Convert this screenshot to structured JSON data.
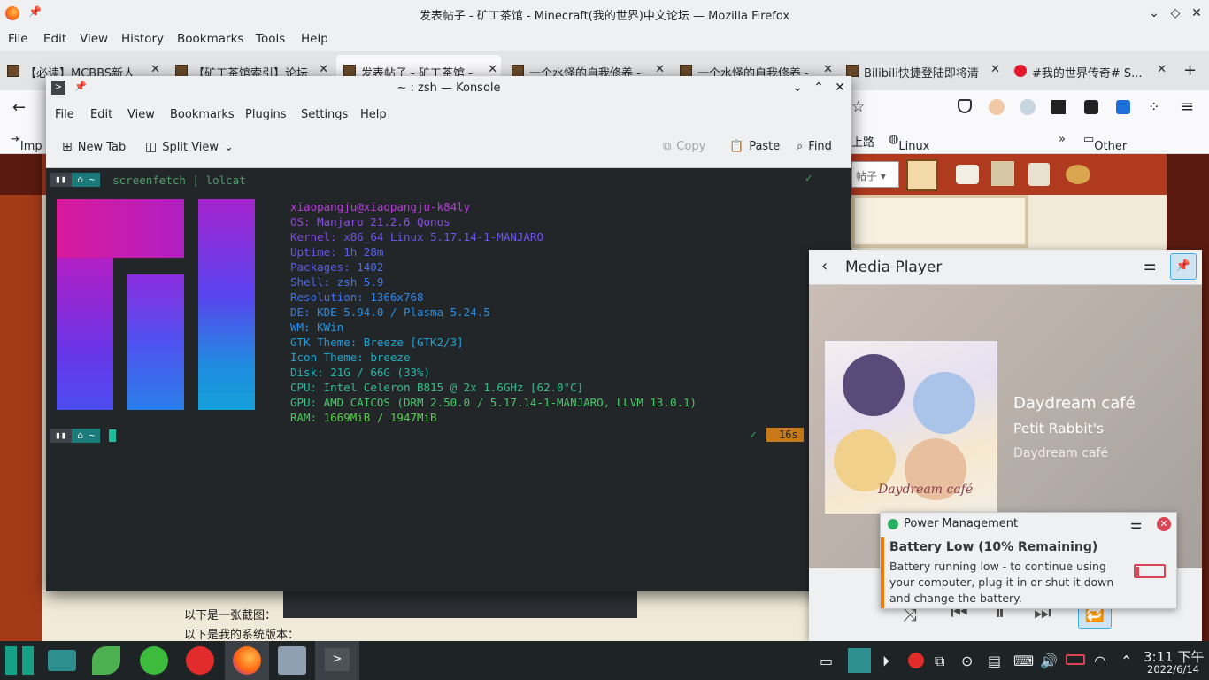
{
  "firefox": {
    "window_title": "发表帖子 - 矿工茶馆 - Minecraft(我的世界)中文论坛 — Mozilla Firefox",
    "menu": [
      "File",
      "Edit",
      "View",
      "History",
      "Bookmarks",
      "Tools",
      "Help"
    ],
    "tabs": [
      {
        "label": "【必读】MCBBS新人"
      },
      {
        "label": "【矿工茶馆索引】论坛"
      },
      {
        "label": "发表帖子 - 矿工茶馆 -"
      },
      {
        "label": "一个水怪的自我修养 -"
      },
      {
        "label": "一个水怪的自我修养 -"
      },
      {
        "label": "Bilibili快捷登陆即将清"
      },
      {
        "label": "#我的世界传奇# S..."
      }
    ],
    "bookmarks": {
      "left": "Imp",
      "partial": "上路",
      "linux": "Linux解决双系统时间...",
      "other": "Other Bookmarks"
    },
    "page": {
      "post_label": "帖子",
      "screenshot_text": "以下是一张截图：",
      "version_text": "以下是我的系统版本："
    }
  },
  "konsole": {
    "title": "~ : zsh — Konsole",
    "menu": [
      "File",
      "Edit",
      "View",
      "Bookmarks",
      "Plugins",
      "Settings",
      "Help"
    ],
    "toolbar": {
      "new_tab": "New Tab",
      "split_view": "Split View",
      "copy": "Copy",
      "paste": "Paste",
      "find": "Find"
    },
    "prompt_home": "~",
    "command": "screenfetch | lolcat",
    "check": "✓",
    "duration": "16s",
    "user_host": "xiaopangju@xiaopangju-k84ly",
    "sysinfo": [
      {
        "key": "OS:",
        "value": " Manjaro 21.2.6 Qonos"
      },
      {
        "key": "Kernel:",
        "value": " x86_64 Linux 5.17.14-1-MANJARO"
      },
      {
        "key": "Uptime:",
        "value": " 1h 28m"
      },
      {
        "key": "Packages:",
        "value": " 1402"
      },
      {
        "key": "Shell:",
        "value": " zsh 5.9"
      },
      {
        "key": "Resolution:",
        "value": " 1366x768"
      },
      {
        "key": "DE:",
        "value": " KDE 5.94.0 / Plasma 5.24.5"
      },
      {
        "key": "WM:",
        "value": " KWin"
      },
      {
        "key": "GTK Theme:",
        "value": " Breeze [GTK2/3]"
      },
      {
        "key": "Icon Theme:",
        "value": " breeze"
      },
      {
        "key": "Disk:",
        "value": " 21G / 66G (33%)"
      },
      {
        "key": "CPU:",
        "value": " Intel Celeron B815 @ 2x 1.6GHz [62.0°C]"
      },
      {
        "key": "GPU:",
        "value": " AMD CAICOS (DRM 2.50.0 / 5.17.14-1-MANJARO, LLVM 13.0.1)"
      },
      {
        "key": "RAM:",
        "value": " 1669MiB / 1947MiB"
      }
    ]
  },
  "media_player": {
    "title": "Media Player",
    "track": "Daydream café",
    "artist": "Petit Rabbit's",
    "album": "Daydream café",
    "album_art_text": "Daydream café"
  },
  "notification": {
    "app": "Power Management",
    "title": "Battery Low (10% Remaining)",
    "body": "Battery running low - to continue using your computer, plug it in or shut it down and change the battery."
  },
  "taskbar": {
    "time": "3:11 下午",
    "date": "2022/6/14"
  },
  "colors": {
    "kde_bg": "#eff0f1",
    "terminal_bg": "#232629",
    "accent_teal": "#1b7a7a",
    "battery_red": "#da4453",
    "notif_accent": "#f67400"
  }
}
